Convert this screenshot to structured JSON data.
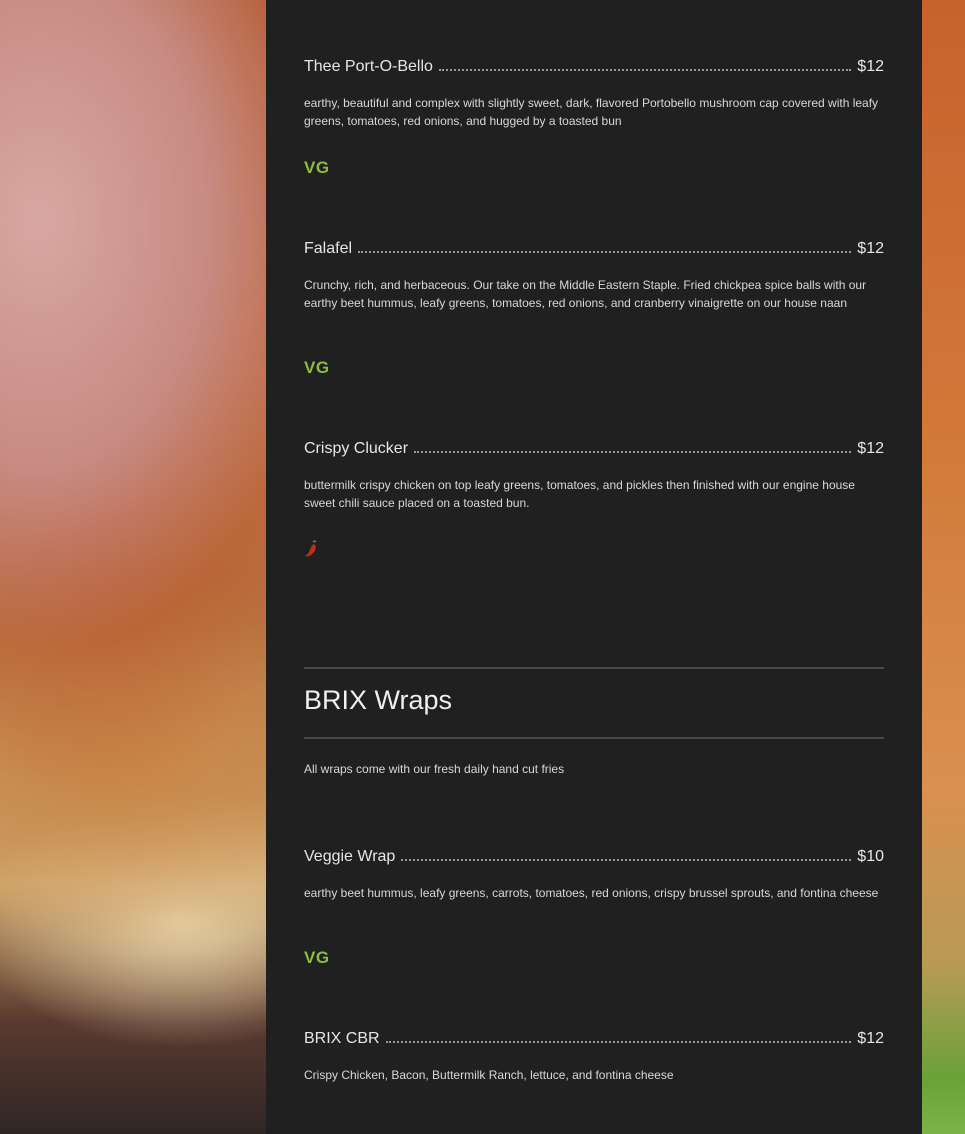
{
  "burgers": [
    {
      "name": "Thee Port-O-Bello",
      "price": "$12",
      "description": "earthy, beautiful and complex with slightly sweet, dark, flavored Portobello mushroom cap covered with leafy greens, tomatoes, red onions, and hugged by a toasted bun",
      "tag": "VG"
    },
    {
      "name": "Falafel",
      "price": "$12",
      "description": "Crunchy, rich, and herbaceous. Our take on the Middle Eastern Staple. Fried chickpea spice balls with our earthy beet hummus, leafy greens, tomatoes, red onions, and cranberry vinaigrette on our house naan",
      "tag": "VG"
    },
    {
      "name": "Crispy Clucker",
      "price": "$12",
      "description": "buttermilk crispy chicken on top leafy greens, tomatoes, and pickles then finished with our engine house sweet chili sauce placed on a toasted bun.",
      "tag_icon": "chili-pepper-icon"
    }
  ],
  "wraps_section": {
    "title": "BRIX Wraps",
    "note": "All wraps come with our fresh daily hand cut fries"
  },
  "wraps": [
    {
      "name": "Veggie Wrap",
      "price": "$10",
      "description": "earthy beet hummus, leafy greens, carrots, tomatoes, red onions, crispy brussel sprouts, and fontina cheese",
      "tag": "VG"
    },
    {
      "name": "BRIX CBR",
      "price": "$12",
      "description": "Crispy Chicken, Bacon, Buttermilk Ranch, lettuce, and fontina cheese"
    }
  ],
  "colors": {
    "panel": "#202020",
    "vegan_tag": "#8cbd3a",
    "hot_tag": "#c0301e"
  }
}
